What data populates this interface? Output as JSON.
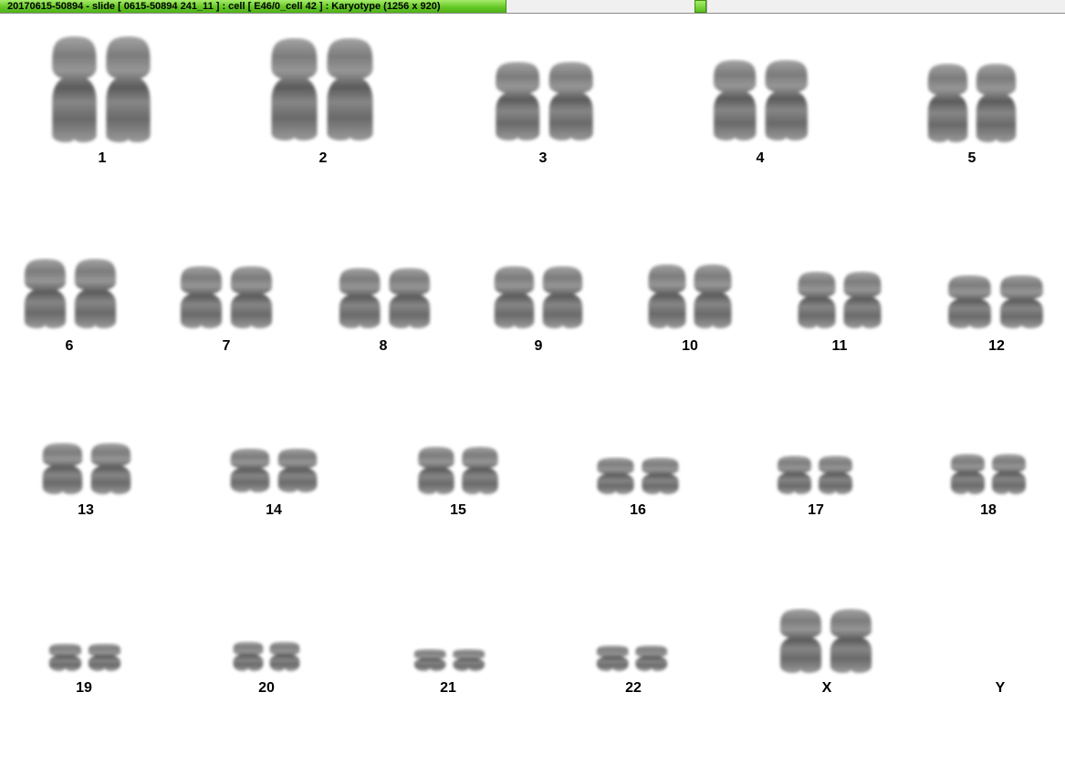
{
  "window": {
    "title": "20170615-50894 - slide [ 0615-50894 241_11 ] : cell [ E46/0_cell 42 ] : Karyotype  (1256 x 920)",
    "accent_color": "#66c926"
  },
  "karyotype": {
    "chromosomes": [
      {
        "label": "1"
      },
      {
        "label": "2"
      },
      {
        "label": "3"
      },
      {
        "label": "4"
      },
      {
        "label": "5"
      },
      {
        "label": "6"
      },
      {
        "label": "7"
      },
      {
        "label": "8"
      },
      {
        "label": "9"
      },
      {
        "label": "10"
      },
      {
        "label": "11"
      },
      {
        "label": "12"
      },
      {
        "label": "13"
      },
      {
        "label": "14"
      },
      {
        "label": "15"
      },
      {
        "label": "16"
      },
      {
        "label": "17"
      },
      {
        "label": "18"
      },
      {
        "label": "19"
      },
      {
        "label": "20"
      },
      {
        "label": "21"
      },
      {
        "label": "22"
      },
      {
        "label": "X"
      },
      {
        "label": "Y"
      }
    ]
  }
}
